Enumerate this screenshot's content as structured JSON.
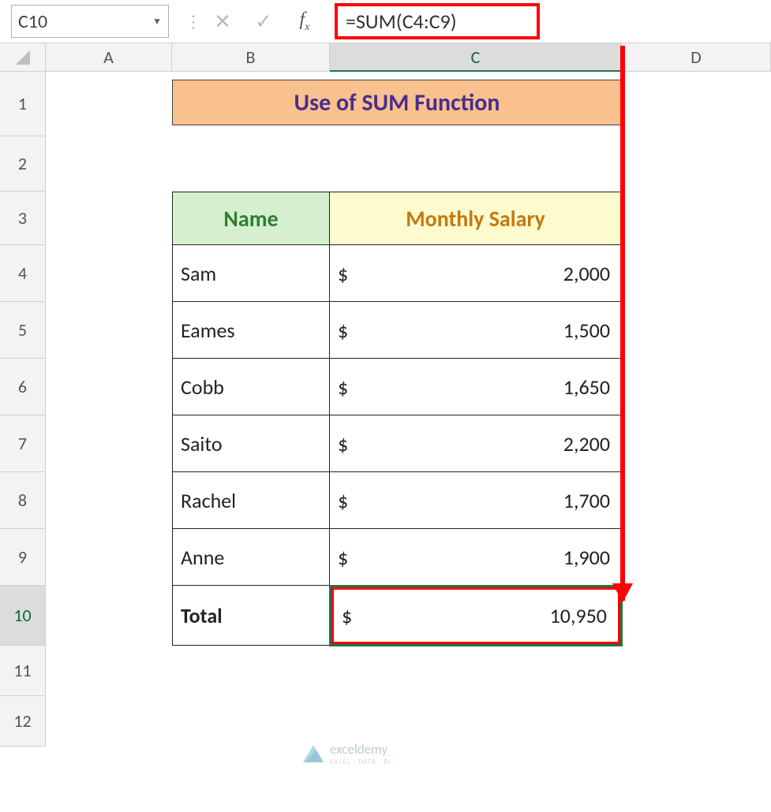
{
  "formula_bar": {
    "name_box": "C10",
    "cancel_icon": "✕",
    "confirm_icon": "✓",
    "fx_label": "fx",
    "formula": "=SUM(C4:C9)"
  },
  "columns": [
    "A",
    "B",
    "C",
    "D"
  ],
  "rows": [
    "1",
    "2",
    "3",
    "4",
    "5",
    "6",
    "7",
    "8",
    "9",
    "10",
    "11",
    "12"
  ],
  "active_cell": {
    "col": "C",
    "row": "10"
  },
  "title": "Use of SUM Function",
  "headers": {
    "name": "Name",
    "salary": "Monthly Salary"
  },
  "currency": "$",
  "data": [
    {
      "name": "Sam",
      "salary": "2,000"
    },
    {
      "name": "Eames",
      "salary": "1,500"
    },
    {
      "name": "Cobb",
      "salary": "1,650"
    },
    {
      "name": "Saito",
      "salary": "2,200"
    },
    {
      "name": "Rachel",
      "salary": "1,700"
    },
    {
      "name": "Anne",
      "salary": "1,900"
    }
  ],
  "total": {
    "label": "Total",
    "salary": "10,950"
  },
  "watermark": {
    "brand": "exceldemy",
    "tag": "EXCEL · DATA · BI"
  },
  "chart_data": {
    "type": "table",
    "title": "Use of SUM Function",
    "columns": [
      "Name",
      "Monthly Salary"
    ],
    "rows": [
      [
        "Sam",
        2000
      ],
      [
        "Eames",
        1500
      ],
      [
        "Cobb",
        1650
      ],
      [
        "Saito",
        2200
      ],
      [
        "Rachel",
        1700
      ],
      [
        "Anne",
        1900
      ],
      [
        "Total",
        10950
      ]
    ],
    "formula_cell": {
      "ref": "C10",
      "formula": "=SUM(C4:C9)",
      "value": 10950
    }
  }
}
